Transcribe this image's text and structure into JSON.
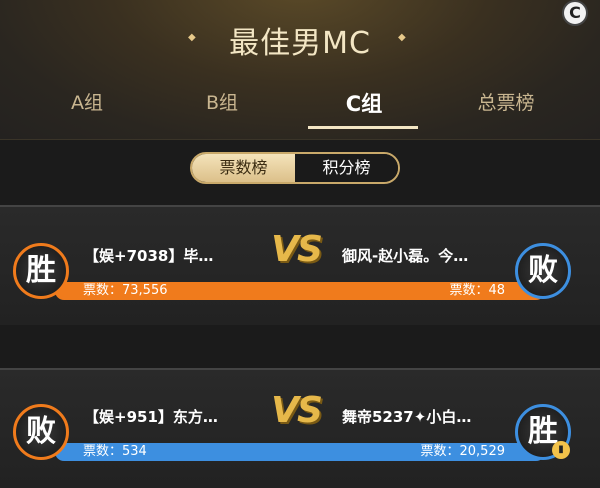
{
  "header": {
    "title": "最佳男MC",
    "corner_badge": "C"
  },
  "tabs": [
    {
      "label": "A组",
      "active": false
    },
    {
      "label": "B组",
      "active": false
    },
    {
      "label": "C组",
      "active": true
    },
    {
      "label": "总票榜",
      "active": false
    }
  ],
  "toggle": {
    "votes_label": "票数榜",
    "points_label": "积分榜",
    "selected": "票数榜"
  },
  "matches": [
    {
      "left_result": "胜",
      "left_name": "【娱+7038】毕…",
      "right_name": "御风-赵小磊。今…",
      "right_result": "败",
      "vs": "VS",
      "left_votes_label": "票数：73,556",
      "right_votes_label": "票数：48",
      "left_votes": 73556,
      "right_votes": 48
    },
    {
      "left_result": "败",
      "left_name": "【娱+951】东方…",
      "right_name": "舞帝5237✦小白…",
      "right_result": "胜",
      "vs": "VS",
      "left_votes_label": "票数：534",
      "right_votes_label": "票数：20,529",
      "left_votes": 534,
      "right_votes": 20529
    }
  ],
  "colors": {
    "win_orange": "#f07b1c",
    "blue": "#3d8fe0",
    "gold": "#e6b84a"
  }
}
